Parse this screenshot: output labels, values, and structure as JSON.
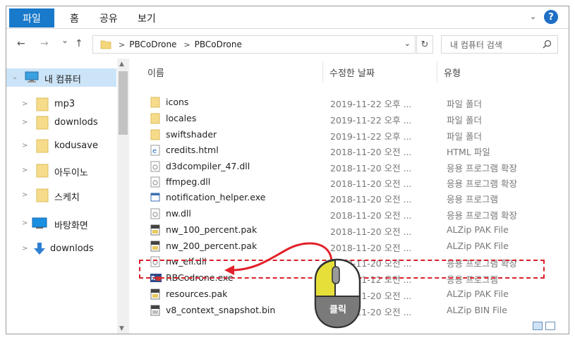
{
  "ribbon": {
    "file_tab": "파일",
    "tabs": [
      "홈",
      "공유",
      "보기"
    ],
    "help": "?"
  },
  "nav": {
    "back": "←",
    "forward": "→",
    "recent": "⌄",
    "up": "↑",
    "breadcrumbs": [
      "PBCoDrone",
      "PBCoDrone"
    ],
    "search_placeholder": "내 컴퓨터 검색"
  },
  "sidebar": {
    "items": [
      {
        "label": "내 컴퓨터",
        "icon": "computer-icon"
      },
      {
        "label": "mp3",
        "icon": "folder-icon"
      },
      {
        "label": "downlods",
        "icon": "folder-icon"
      },
      {
        "label": "kodusave",
        "icon": "folder-icon"
      },
      {
        "label": "아두이노",
        "icon": "folder-icon"
      },
      {
        "label": "스케치",
        "icon": "folder-icon"
      },
      {
        "label": "바탕화면",
        "icon": "desktop-icon"
      },
      {
        "label": "downlods",
        "icon": "download-icon"
      }
    ]
  },
  "columns": {
    "name": "이름",
    "date": "수정한 날짜",
    "type": "유형"
  },
  "files": [
    {
      "name": "icons",
      "date": "2019-11-22 오후 ...",
      "type": "파일 폴더",
      "icon": "folder-icon"
    },
    {
      "name": "locales",
      "date": "2019-11-22 오후 ...",
      "type": "파일 폴더",
      "icon": "folder-icon"
    },
    {
      "name": "swiftshader",
      "date": "2019-11-22 오후 ...",
      "type": "파일 폴더",
      "icon": "folder-icon"
    },
    {
      "name": "credits.html",
      "date": "2018-11-20 오전 ...",
      "type": "HTML 파일",
      "icon": "html-icon"
    },
    {
      "name": "d3dcompiler_47.dll",
      "date": "2018-11-20 오전 ...",
      "type": "응용 프로그램 확장",
      "icon": "dll-icon"
    },
    {
      "name": "ffmpeg.dll",
      "date": "2018-11-20 오전 ...",
      "type": "응용 프로그램 확장",
      "icon": "dll-icon"
    },
    {
      "name": "notification_helper.exe",
      "date": "2018-11-20 오전 ...",
      "type": "응용 프로그램",
      "icon": "exe-icon"
    },
    {
      "name": "nw.dll",
      "date": "2018-11-20 오전 ...",
      "type": "응용 프로그램 확장",
      "icon": "dll-icon"
    },
    {
      "name": "nw_100_percent.pak",
      "date": "2018-11-20 오전 ...",
      "type": "ALZip PAK File",
      "icon": "pak-icon"
    },
    {
      "name": "nw_200_percent.pak",
      "date": "2018-11-20 오전 ...",
      "type": "ALZip PAK File",
      "icon": "pak-icon"
    },
    {
      "name": "nw_elf.dll",
      "date": "2018-11-20 오전 ...",
      "type": "응용 프로그램 확장",
      "icon": "dll-icon"
    },
    {
      "name": "RBCodrone.exe",
      "date": "2019-11-12 오전 ...",
      "type": "응용 프로그램",
      "icon": "rbcodrone-exe-icon"
    },
    {
      "name": "resources.pak",
      "date": "2018-11-20 오전 ...",
      "type": "ALZip PAK File",
      "icon": "pak-icon"
    },
    {
      "name": "v8_context_snapshot.bin",
      "date": "2018-11-20 오전 ...",
      "type": "ALZip BIN File",
      "icon": "bin-icon"
    }
  ],
  "callout": {
    "label": "클릭"
  },
  "colors": {
    "accent": "#1979ca",
    "highlight": "#d8202a",
    "mouse_yellow": "#e6df3a"
  }
}
